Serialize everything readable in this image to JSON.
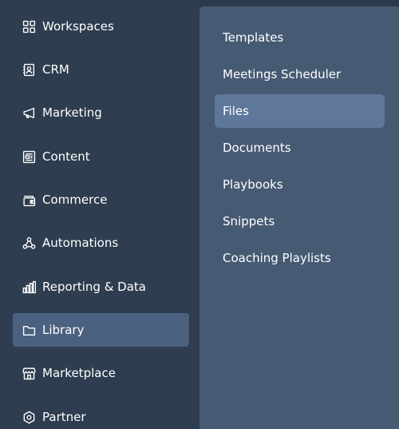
{
  "sidebar": {
    "items": [
      {
        "label": "Workspaces",
        "icon": "grid-icon"
      },
      {
        "label": "CRM",
        "icon": "contacts-icon"
      },
      {
        "label": "Marketing",
        "icon": "megaphone-icon"
      },
      {
        "label": "Content",
        "icon": "content-icon"
      },
      {
        "label": "Commerce",
        "icon": "wallet-icon"
      },
      {
        "label": "Automations",
        "icon": "automations-icon"
      },
      {
        "label": "Reporting & Data",
        "icon": "bar-chart-icon"
      },
      {
        "label": "Library",
        "icon": "folder-icon"
      },
      {
        "label": "Marketplace",
        "icon": "storefront-icon"
      },
      {
        "label": "Partner",
        "icon": "hexagon-icon"
      }
    ],
    "active_item": "Library"
  },
  "submenu": {
    "items": [
      {
        "label": "Templates"
      },
      {
        "label": "Meetings Scheduler"
      },
      {
        "label": "Files"
      },
      {
        "label": "Documents"
      },
      {
        "label": "Playbooks"
      },
      {
        "label": "Snippets"
      },
      {
        "label": "Coaching Playlists"
      }
    ],
    "active_item": "Files"
  },
  "colors": {
    "sidebar_bg": "#2e3d4f",
    "submenu_bg": "#475a74",
    "sidebar_active_bg": "#4b6180",
    "submenu_active_bg": "#5f779b",
    "text": "#ffffff"
  }
}
